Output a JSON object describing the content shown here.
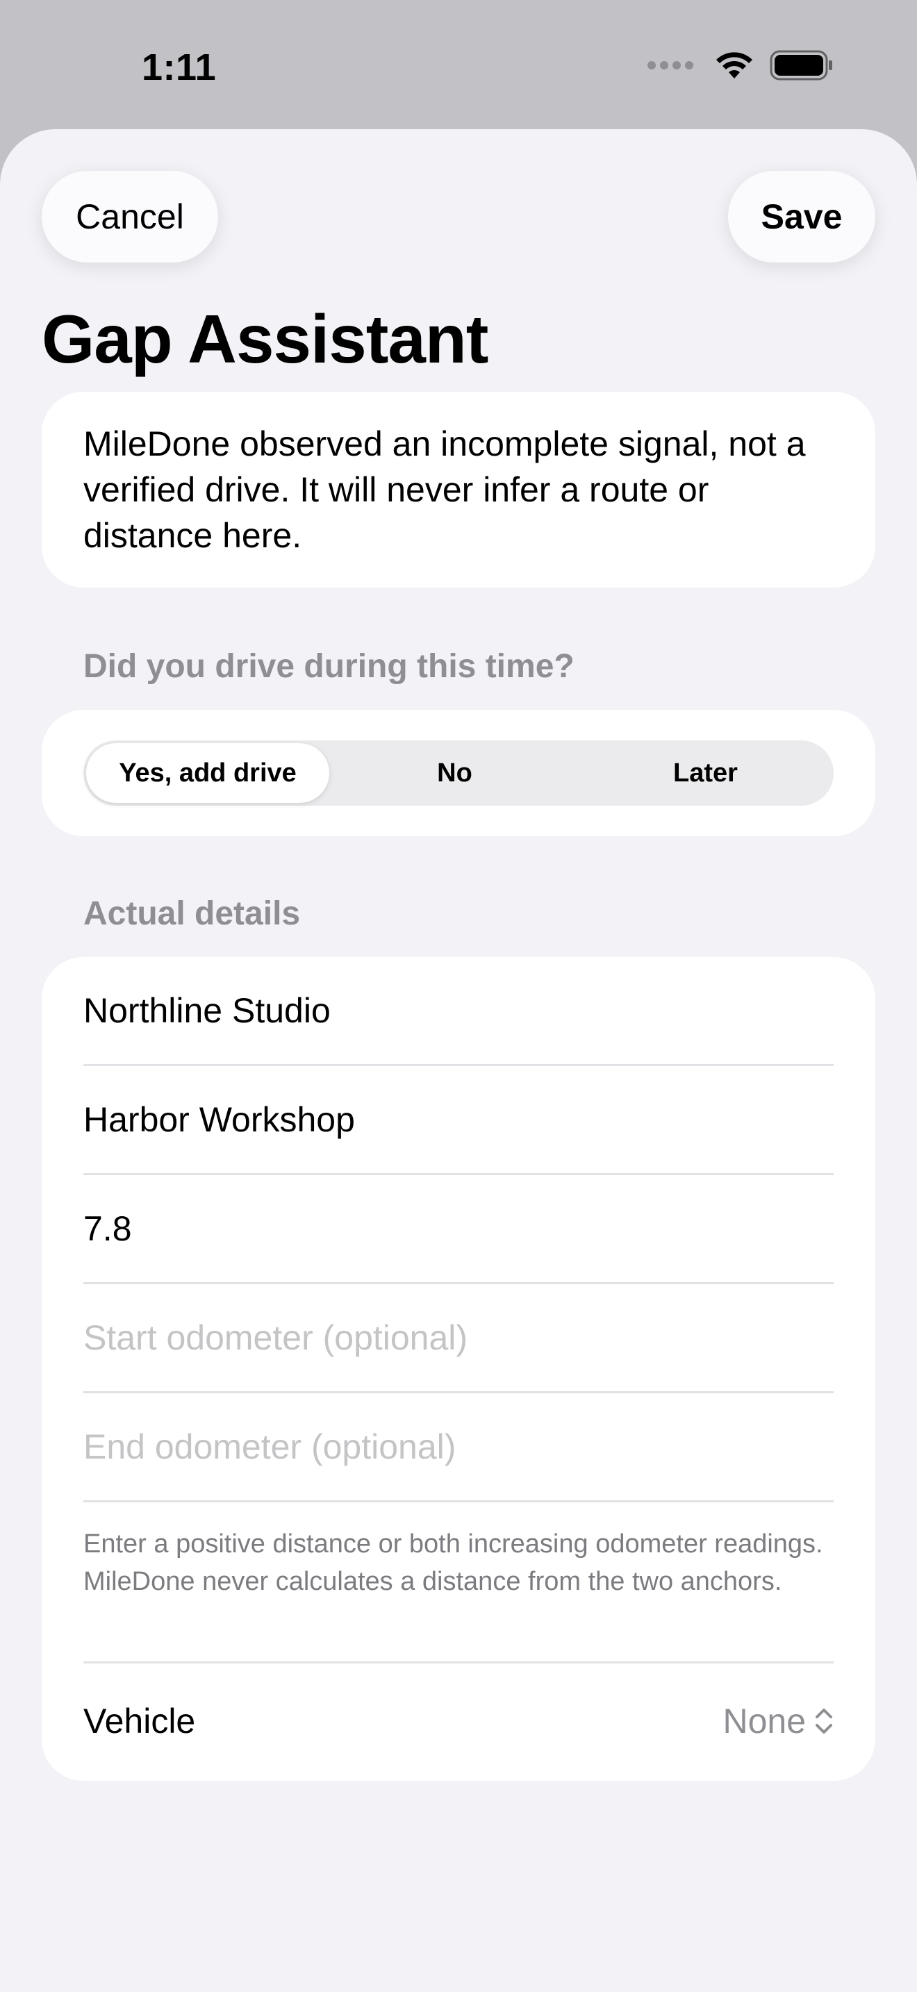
{
  "status_bar": {
    "time": "1:11"
  },
  "nav": {
    "cancel_label": "Cancel",
    "save_label": "Save"
  },
  "title": "Gap Assistant",
  "info": {
    "text": "MileDone observed an incomplete signal, not a verified drive. It will never infer a route or distance here."
  },
  "question": {
    "header": "Did you drive during this time?",
    "options": [
      {
        "label": "Yes, add drive",
        "selected": true
      },
      {
        "label": "No",
        "selected": false
      },
      {
        "label": "Later",
        "selected": false
      }
    ]
  },
  "details": {
    "header": "Actual details",
    "start_location": {
      "value": "Northline Studio"
    },
    "end_location": {
      "value": "Harbor Workshop"
    },
    "distance": {
      "value": "7.8"
    },
    "start_odometer": {
      "value": "",
      "placeholder": "Start odometer (optional)"
    },
    "end_odometer": {
      "value": "",
      "placeholder": "End odometer (optional)"
    },
    "note": "Enter a positive distance or both increasing odometer readings. MileDone never calculates a distance from the two anchors.",
    "vehicle": {
      "label": "Vehicle",
      "value": "None"
    }
  },
  "colors": {
    "background": "#f2f2f7",
    "card": "#ffffff",
    "secondary_text": "#8e8e93",
    "placeholder": "#c4c4c7"
  }
}
